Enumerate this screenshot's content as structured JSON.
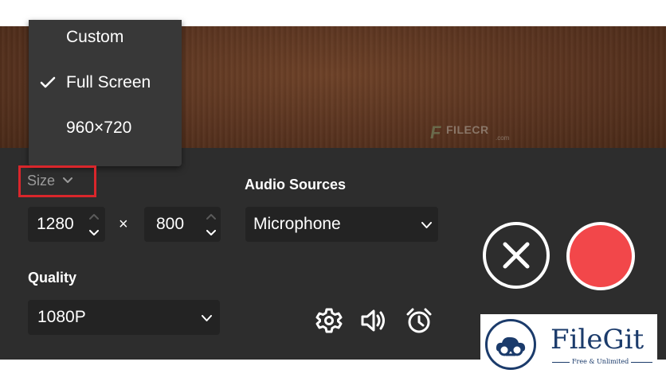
{
  "preview": {
    "watermark_text": "FILECR",
    "watermark_sub": ".com"
  },
  "size_menu": {
    "items": [
      {
        "label": "Custom",
        "checked": false
      },
      {
        "label": "Full Screen",
        "checked": true
      },
      {
        "label": "960×720",
        "checked": false
      }
    ]
  },
  "size": {
    "label": "Size",
    "width": "1280",
    "separator": "×",
    "height": "800"
  },
  "audio": {
    "label": "Audio Sources",
    "value": "Microphone"
  },
  "quality": {
    "label": "Quality",
    "value": "1080P"
  },
  "icons": [
    "gear-icon",
    "speaker-icon",
    "alarm-clock-icon",
    "close-icon",
    "chevron-down-icon",
    "checkmark-icon"
  ],
  "colors": {
    "panel_bg": "#2d2d2d",
    "field_bg": "#232323",
    "record_red": "#f2474a",
    "highlight_red": "#d9262b",
    "logo_blue": "#1b3b6b"
  },
  "logo": {
    "name": "FileGit",
    "tagline": "Free & Unlimited"
  }
}
